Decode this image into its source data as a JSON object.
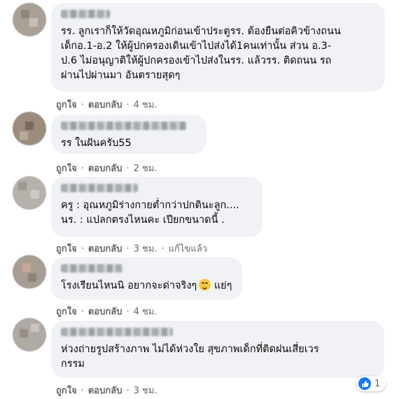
{
  "comments": [
    {
      "text": "รร. ลูกเราก็ให้วัดอุณหภูมิก่อนเข้าประตูรร. ต้องยืนต่อคิวข้างถนน\nเด็กอ.1-อ.2 ให้ผู้ปกครองเดินเข้าไปส่งได้1คนเท่านั้น ส่วน อ.3-\nป.6 ไม่อนุญาติให้ผู้ปกครองเข้าไปส่งในรร. แล้วรร. ติดถนน รถ\nผ่านไปผ่านมา อันตรายสุดๆ",
      "like": "ถูกใจ",
      "reply": "ตอบกลับ",
      "time": "4 ชม.",
      "edited": ""
    },
    {
      "text": "รร ในฝันครับ55",
      "like": "ถูกใจ",
      "reply": "ตอบกลับ",
      "time": "2 ชม.",
      "edited": ""
    },
    {
      "text": "ครู : อุณหภูมิร่างกายต่ำกว่าปกตินะลูก....\nนร. : แปลกตรงไหนคะ เปียกขนาดนี้ .",
      "like": "ถูกใจ",
      "reply": "ตอบกลับ",
      "time": "3 ชม.",
      "edited": "แก้ไขแล้ว"
    },
    {
      "text_before": "โรงเรียนไหนนิ อยากจะด่าจริงๆ",
      "emoji": "smirk-emoji",
      "text_after": " แย่ๆ",
      "like": "ถูกใจ",
      "reply": "ตอบกลับ",
      "time": "4 ชม.",
      "edited": ""
    },
    {
      "text": "ห่วงถ่ายรูปสร้างภาพ ไม่ได้ห่วงใย สุขภาพเด็กที่ติดฝนเสี่ยเวร\nกรรม",
      "like": "ถูกใจ",
      "reply": "ตอบกลับ",
      "time": "3 ชม.",
      "edited": "",
      "reaction": {
        "icon": "thumbs-up-icon",
        "count": "1",
        "color": "#1877f2"
      }
    }
  ],
  "separator": "·",
  "colors": {
    "bubble": "#f0f2f5",
    "meta": "#65676b",
    "text": "#050505"
  }
}
